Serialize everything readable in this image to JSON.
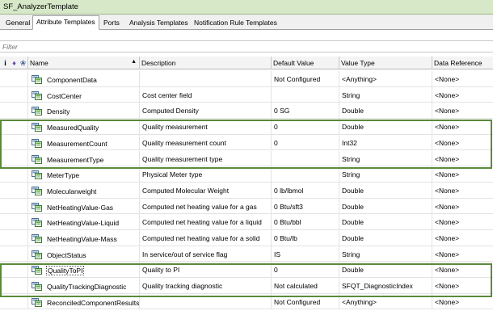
{
  "window": {
    "title": "SF_AnalyzerTemplate"
  },
  "tabs": [
    {
      "label": "General",
      "active": false
    },
    {
      "label": "Attribute Templates",
      "active": true
    },
    {
      "label": "Ports",
      "active": false
    },
    {
      "label": "Analysis Templates",
      "active": false
    },
    {
      "label": "Notification Rule Templates",
      "active": false
    }
  ],
  "filter": {
    "placeholder": "Filter"
  },
  "grid": {
    "header_icons": [
      "i",
      "♦",
      "❀"
    ],
    "columns": [
      "Name",
      "Description",
      "Default Value",
      "Value Type",
      "Data Reference"
    ],
    "rows": [
      {
        "name": "ComponentData",
        "description": "",
        "default": "Not Configured",
        "type": "<Anything>",
        "ref": "<None>"
      },
      {
        "name": "CostCenter",
        "description": "Cost center field",
        "default": "",
        "type": "String",
        "ref": "<None>"
      },
      {
        "name": "Density",
        "description": "Computed Density",
        "default": "0 SG",
        "type": "Double",
        "ref": "<None>"
      },
      {
        "name": "MeasuredQuality",
        "description": "Quality measurement",
        "default": "0",
        "type": "Double",
        "ref": "<None>"
      },
      {
        "name": "MeasurementCount",
        "description": "Quality measurement count",
        "default": "0",
        "type": "Int32",
        "ref": "<None>"
      },
      {
        "name": "MeasurementType",
        "description": "Quality measurement type",
        "default": "",
        "type": "String",
        "ref": "<None>"
      },
      {
        "name": "MeterType",
        "description": "Physical Meter type",
        "default": "",
        "type": "String",
        "ref": "<None>"
      },
      {
        "name": "Molecularweight",
        "description": "Computed Molecular Weight",
        "default": "0 lb/lbmol",
        "type": "Double",
        "ref": "<None>"
      },
      {
        "name": "NetHeatingValue-Gas",
        "description": "Computed net heating value for a gas",
        "default": "0 Btu/sft3",
        "type": "Double",
        "ref": "<None>"
      },
      {
        "name": "NetHeatingValue-Liquid",
        "description": "Computed net heating value for a liquid",
        "default": "0 Btu/bbl",
        "type": "Double",
        "ref": "<None>"
      },
      {
        "name": "NetHeatingValue-Mass",
        "description": "Computed net heating value for a solid",
        "default": "0 Btu/lb",
        "type": "Double",
        "ref": "<None>"
      },
      {
        "name": "ObjectStatus",
        "description": "In service/out of service flag",
        "default": "IS",
        "type": "String",
        "ref": "<None>"
      },
      {
        "name": "QualityToPI",
        "description": "Quality to PI",
        "default": "0",
        "type": "Double",
        "ref": "<None>"
      },
      {
        "name": "QualityTrackingDiagnostic",
        "description": "Quality tracking diagnostic",
        "default": "Not calculated",
        "type": "SFQT_DiagnosticIndex",
        "ref": "<None>"
      },
      {
        "name": "ReconciledComponentResults",
        "description": "",
        "default": "Not Configured",
        "type": "<Anything>",
        "ref": "<None>"
      }
    ]
  },
  "colors": {
    "highlight": "#5b8a3a",
    "title_bg": "#d7e8c9"
  }
}
